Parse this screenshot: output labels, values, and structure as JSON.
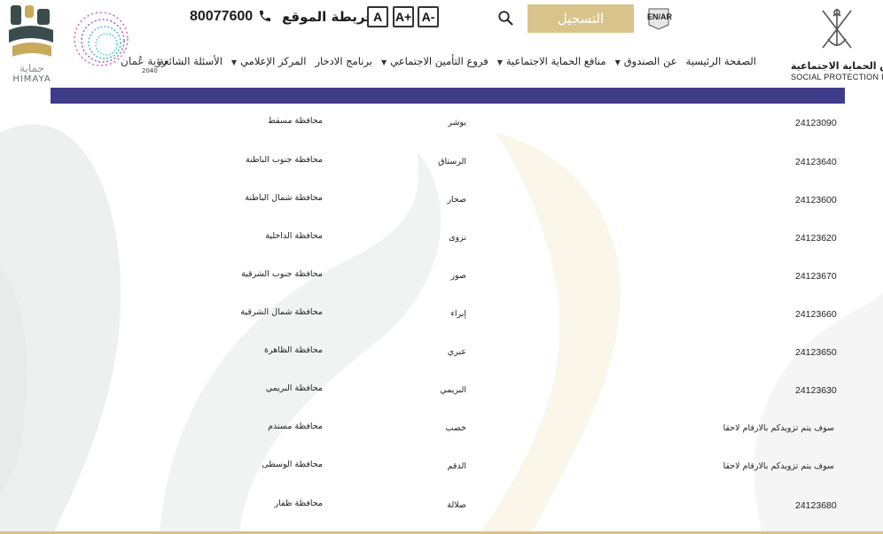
{
  "header": {
    "phone": "80077600",
    "sitemap_label": "خريطة الموقع",
    "font_buttons": [
      "A",
      "A+",
      "A-"
    ],
    "register_label": "التسجيل",
    "lang_badge": "EN/AR",
    "org_name_ar": "صندوق الحماية الاجتماعية",
    "org_name_en": "SOCIAL PROTECTION FUND",
    "himaya_ar": "حماية",
    "himaya_en": "HIMAYA",
    "vision_text": "رؤية عُمان",
    "vision_year": "2040"
  },
  "nav": {
    "items": [
      {
        "label": "الصفحة الرئيسية",
        "dropdown": false
      },
      {
        "label": "عن الصندوق",
        "dropdown": true
      },
      {
        "label": "منافع الحماية الاجتماعية",
        "dropdown": true
      },
      {
        "label": "فروع التأمين الاجتماعي",
        "dropdown": true
      },
      {
        "label": "برنامج الادخار",
        "dropdown": false
      },
      {
        "label": "المركز الإعلامي",
        "dropdown": true
      },
      {
        "label": "الأسئلة الشائعة",
        "dropdown": false
      }
    ]
  },
  "table": {
    "rows": [
      {
        "phone": "24123090",
        "city": "بوشر",
        "governorate": "محافظة مسقط"
      },
      {
        "phone": "24123640",
        "city": "الرستاق",
        "governorate": "محافظة جنوب الباطنة"
      },
      {
        "phone": "24123600",
        "city": "صحار",
        "governorate": "محافظة شمال الباطنة"
      },
      {
        "phone": "24123620",
        "city": "نزوى",
        "governorate": "محافظة الداخلية"
      },
      {
        "phone": "24123670",
        "city": "صور",
        "governorate": "محافظة جنوب الشرقية"
      },
      {
        "phone": "24123660",
        "city": "إبراء",
        "governorate": "محافظة شمال الشرقية"
      },
      {
        "phone": "24123650",
        "city": "عبري",
        "governorate": "محافظة الظاهرة"
      },
      {
        "phone": "24123630",
        "city": "البريمي",
        "governorate": "محافظة البريمي"
      },
      {
        "phone": "سوف يتم تزويدكم بالارقام لاحقا",
        "city": "خصب",
        "governorate": "محافظة مسندم"
      },
      {
        "phone": "سوف يتم تزويدكم بالارقام لاحقا",
        "city": "الدقم",
        "governorate": "محافظة الوسطى"
      },
      {
        "phone": "24123680",
        "city": "صلالة",
        "governorate": "محافظة ظفار"
      }
    ]
  },
  "colors": {
    "accent_gold": "#d8c48a",
    "table_header": "#3f3d8a"
  }
}
